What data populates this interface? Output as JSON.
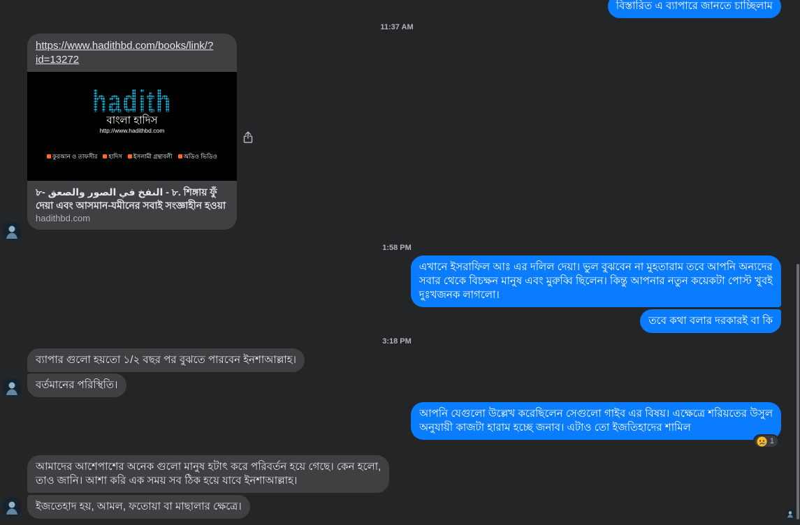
{
  "colors": {
    "background": "#242526",
    "outgoing_bubble": "#0a7cff",
    "incoming_bubble": "#3e4042",
    "primary_text": "#e4e6eb",
    "secondary_text": "#b0b3b8",
    "logo_cyan": "#1ab8e0",
    "menu_icon_orange": "#ff6a13",
    "reaction_yellow": "#f7b928"
  },
  "icons": {
    "avatar": "contact-avatar",
    "share": "share-icon",
    "seen": "seen-avatar-icon"
  },
  "timestamps": [
    "11:37 AM",
    "1:58 PM",
    "3:18 PM"
  ],
  "messages": [
    {
      "lines": [
        "বিস্তারিত এ ব্যাপারে জানতে চাচ্ছিলাম"
      ]
    },
    {
      "link_preview": {
        "url": "https://www.hadithbd.com/books/link/?id=13272",
        "image": {
          "logo_text": "hadith",
          "site_name": "বাংলা হাদিস",
          "site_url": "http://www.hadithbd.com",
          "menu": [
            {
              "icon": "book-icon",
              "label": "কুরআন ও তাফসীর"
            },
            {
              "icon": "hadith-icon",
              "label": "হাদিস"
            },
            {
              "icon": "library-icon",
              "label": "ইসলামী গ্রন্থাবলী"
            },
            {
              "icon": "speaker-icon",
              "label": "অডিও ভিডিও"
            }
          ]
        },
        "title": "৮- النفخ في الصور والصعق - ৮. শিঙ্গায় ফুঁ দেয়া এবং আসমান-যমীনের সবাই সংজ্ঞাহীন হওয়া",
        "domain": "hadithbd.com"
      }
    },
    {
      "lines": [
        "এখানে ইসরাফিল আঃ এর দলিল দেয়া। ভুল বুঝবেন না মুহতারাম তবে আপনি অন্যদের",
        "সবার থেকে বিচক্ষন মানুষ এবং মুরুব্বি ছিলেন। কিন্তু আপনার নতুন কয়েকটা পোস্ট খুবই",
        "দুঃখজনক লাগলো।"
      ]
    },
    {
      "lines": [
        "তবে কথা বলার দরকারই বা কি"
      ]
    },
    {
      "lines": [
        "ব্যাপার গুলো হয়তো ১/২ বছর পর বুঝতে পারবেন ইনশাআল্লাহ।"
      ]
    },
    {
      "lines": [
        "বর্তমানের পরিস্থিতি।"
      ]
    },
    {
      "lines": [
        "আপনি যেগুলো উল্লেখ করেছিলেন সেগুলো গাইব এর বিষয়। এক্ষেত্রে শরিয়তের উসুল",
        "অনুযায়ী কাজটা হারাম হচ্ছে জনাব। এটাও তো ইজতিহাদের শামিল"
      ],
      "reaction": {
        "icon": "sad-reaction-icon",
        "count": "1"
      }
    },
    {
      "lines": [
        "আমাদের আশেপাশের অনেক গুলো মানুষ হটাৎ করে পরিবর্তন হয়ে গেছে। কেন হলো,",
        "তাও জানি। আশা করি এক সময় সব ঠিক হয়ে যাবে ইনশাআল্লাহ।"
      ]
    },
    {
      "lines": [
        "ইজতেহাদ হয়, আমল, ফতোয়া বা মাছালার ক্ষেত্রে।"
      ]
    }
  ]
}
